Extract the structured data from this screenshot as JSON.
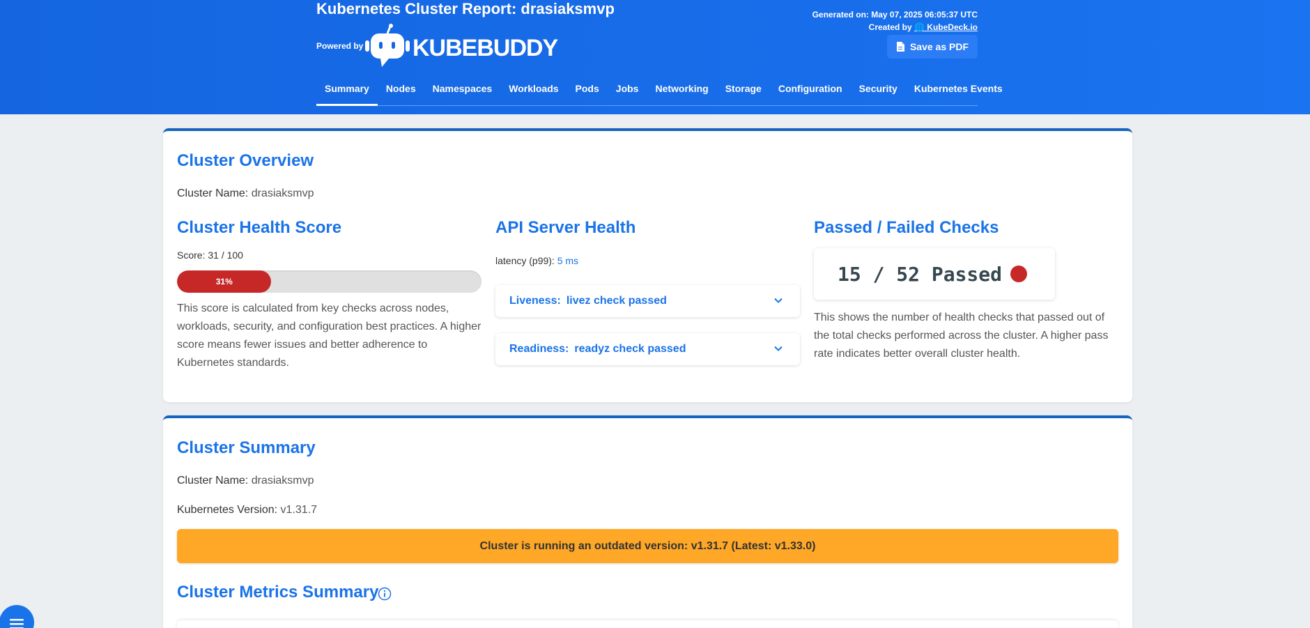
{
  "header": {
    "title": "Kubernetes Cluster Report: drasiaksmvp",
    "powered_by": "Powered by",
    "logo_text": "KUBEBUDDY",
    "generated": "Generated on: May 07, 2025 06:05:37 UTC",
    "created_by_label": "Created by",
    "created_by_link": "🌐 KubeDeck.io",
    "save_pdf": "Save as PDF"
  },
  "nav": {
    "items": [
      "Summary",
      "Nodes",
      "Namespaces",
      "Workloads",
      "Pods",
      "Jobs",
      "Networking",
      "Storage",
      "Configuration",
      "Security",
      "Kubernetes Events"
    ],
    "active": "Summary"
  },
  "overview": {
    "title": "Cluster Overview",
    "cluster_name_label": "Cluster Name:",
    "cluster_name": "drasiaksmvp",
    "health": {
      "title": "Cluster Health Score",
      "score_label": "Score:",
      "score_value": "31 / 100",
      "score_fraction": 0.31,
      "bar_label": "31%",
      "description": "This score is calculated from key checks across nodes, workloads, security, and configuration best practices. A higher score means fewer issues and better adherence to Kubernetes standards."
    },
    "api": {
      "title": "API Server Health",
      "latency_label": "latency (p99):",
      "latency_value": "5 ms",
      "liveness_label": "Liveness:",
      "liveness_value": "livez check passed",
      "readiness_label": "Readiness:",
      "readiness_value": "readyz check passed"
    },
    "checks": {
      "title": "Passed / Failed Checks",
      "summary": "15 / 52  Passed",
      "status_color": "#c62828",
      "description": "This shows the number of health checks that passed out of the total checks performed across the cluster. A higher pass rate indicates better overall cluster health."
    }
  },
  "summary": {
    "title": "Cluster Summary",
    "cluster_name_label": "Cluster Name:",
    "cluster_name": "drasiaksmvp",
    "version_label": "Kubernetes Version:",
    "version": "v1.31.7",
    "alert": "Cluster is running an outdated version: v1.31.7 (Latest: v1.33.0)",
    "metrics_title": "Cluster Metrics Summary"
  },
  "colors": {
    "accent": "#1a73e8",
    "header": "#1565e0",
    "danger": "#c62828",
    "warning": "#ffa726"
  }
}
